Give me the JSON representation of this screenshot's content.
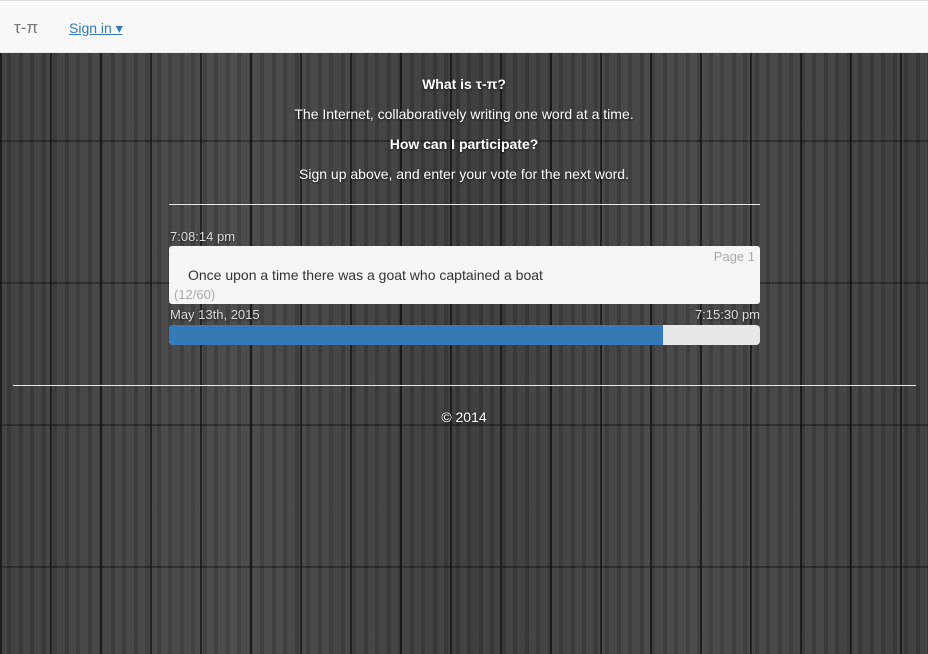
{
  "navbar": {
    "brand": "τ-π",
    "signin_label": "Sign in ▾"
  },
  "intro": {
    "q1": "What is τ-π?",
    "a1": "The Internet, collaboratively writing one word at a time.",
    "q2": "How can I participate?",
    "a2": "Sign up above, and enter your vote for the next word."
  },
  "story": {
    "time": "7:08:14 pm",
    "page": "Page 1",
    "text": "Once upon a time there was a goat who captained a boat",
    "word_count": "(12/60)",
    "date": "May 13th, 2015",
    "end_time": "7:15:30 pm",
    "progress_fraction": 0.836
  },
  "footer": {
    "copyright": "© 2014"
  },
  "colors": {
    "accent": "#337ab7",
    "navbar_bg": "#f8f8f8"
  }
}
